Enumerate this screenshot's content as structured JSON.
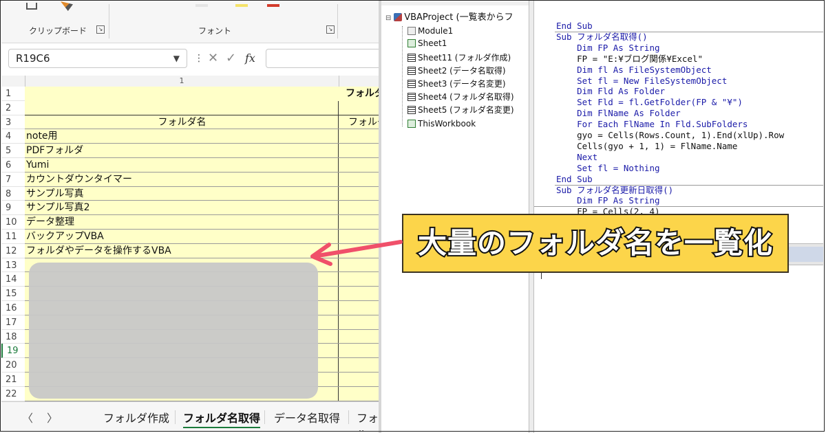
{
  "excel": {
    "ribbon": {
      "clipboard_label": "クリップボード",
      "font_label": "フォント",
      "launcher_glyph": "↘"
    },
    "name_box": "R19C6",
    "formula_icons": {
      "cancel": "✕",
      "enter": "✓",
      "fx": "fx"
    },
    "column_header": "1",
    "rows": [
      {
        "n": "1",
        "a": "",
        "b": "フォルダ"
      },
      {
        "n": "2",
        "a": "",
        "b": ""
      },
      {
        "n": "3",
        "a": "フォルダ名",
        "b": "フォルダ"
      },
      {
        "n": "4",
        "a": "note用",
        "b": ""
      },
      {
        "n": "5",
        "a": "PDFフォルダ",
        "b": ""
      },
      {
        "n": "6",
        "a": "Yumi",
        "b": ""
      },
      {
        "n": "7",
        "a": "カウントダウンタイマー",
        "b": ""
      },
      {
        "n": "8",
        "a": "サンプル写真",
        "b": ""
      },
      {
        "n": "9",
        "a": "サンプル写真2",
        "b": ""
      },
      {
        "n": "10",
        "a": "データ整理",
        "b": ""
      },
      {
        "n": "11",
        "a": "バックアップVBA",
        "b": ""
      },
      {
        "n": "12",
        "a": "フォルダやデータを操作するVBA",
        "b": ""
      },
      {
        "n": "13",
        "a": "",
        "b": ""
      },
      {
        "n": "14",
        "a": "",
        "b": ""
      },
      {
        "n": "15",
        "a": "",
        "b": ""
      },
      {
        "n": "16",
        "a": "",
        "b": ""
      },
      {
        "n": "17",
        "a": "",
        "b": ""
      },
      {
        "n": "18",
        "a": "",
        "b": ""
      },
      {
        "n": "19",
        "a": "",
        "b": ""
      },
      {
        "n": "20",
        "a": "",
        "b": ""
      },
      {
        "n": "21",
        "a": "",
        "b": ""
      },
      {
        "n": "22",
        "a": "",
        "b": ""
      }
    ],
    "sheet_tabs": [
      "フォルダ作成",
      "フォルダ名取得",
      "データ名取得",
      "フォル"
    ],
    "active_tab": "フォルダ名取得"
  },
  "vbe": {
    "tree": {
      "project": "VBAProject (一覧表からフ",
      "items": [
        "Module1",
        "Sheet1",
        "Sheet11 (フォルダ作成)",
        "Sheet2 (データ名取得)",
        "Sheet3 (データ名変更)",
        "Sheet4 (フォルダ名取得)",
        "Sheet5 (フォルダ名変更)",
        "ThisWorkbook"
      ]
    },
    "code_lines": [
      "End Sub",
      "Sub フォルダ名取得()",
      "    Dim FP As String",
      "    FP = \"E:¥ブログ関係¥Excel\"",
      "    Dim fl As FileSystemObject",
      "    Set fl = New FileSystemObject",
      "    Dim Fld As Folder",
      "    Set Fld = fl.GetFolder(FP & \"¥\")",
      "    Dim FlName As Folder",
      "    For Each FlName In Fld.SubFolders",
      "    gyo = Cells(Rows.Count, 1).End(xlUp).Row",
      "    Cells(gyo + 1, 1) = FlName.Name",
      "    Next",
      "    Set fl = Nothing",
      "End Sub",
      "Sub フォルダ名更新日取得()",
      "    Dim FP As String",
      "    FP = Cells(2, 4)"
    ]
  },
  "callout": {
    "text": "大量のフォルダ名を一覧化",
    "bg": "#fcd54a",
    "arrow_color": "#f0506a"
  }
}
